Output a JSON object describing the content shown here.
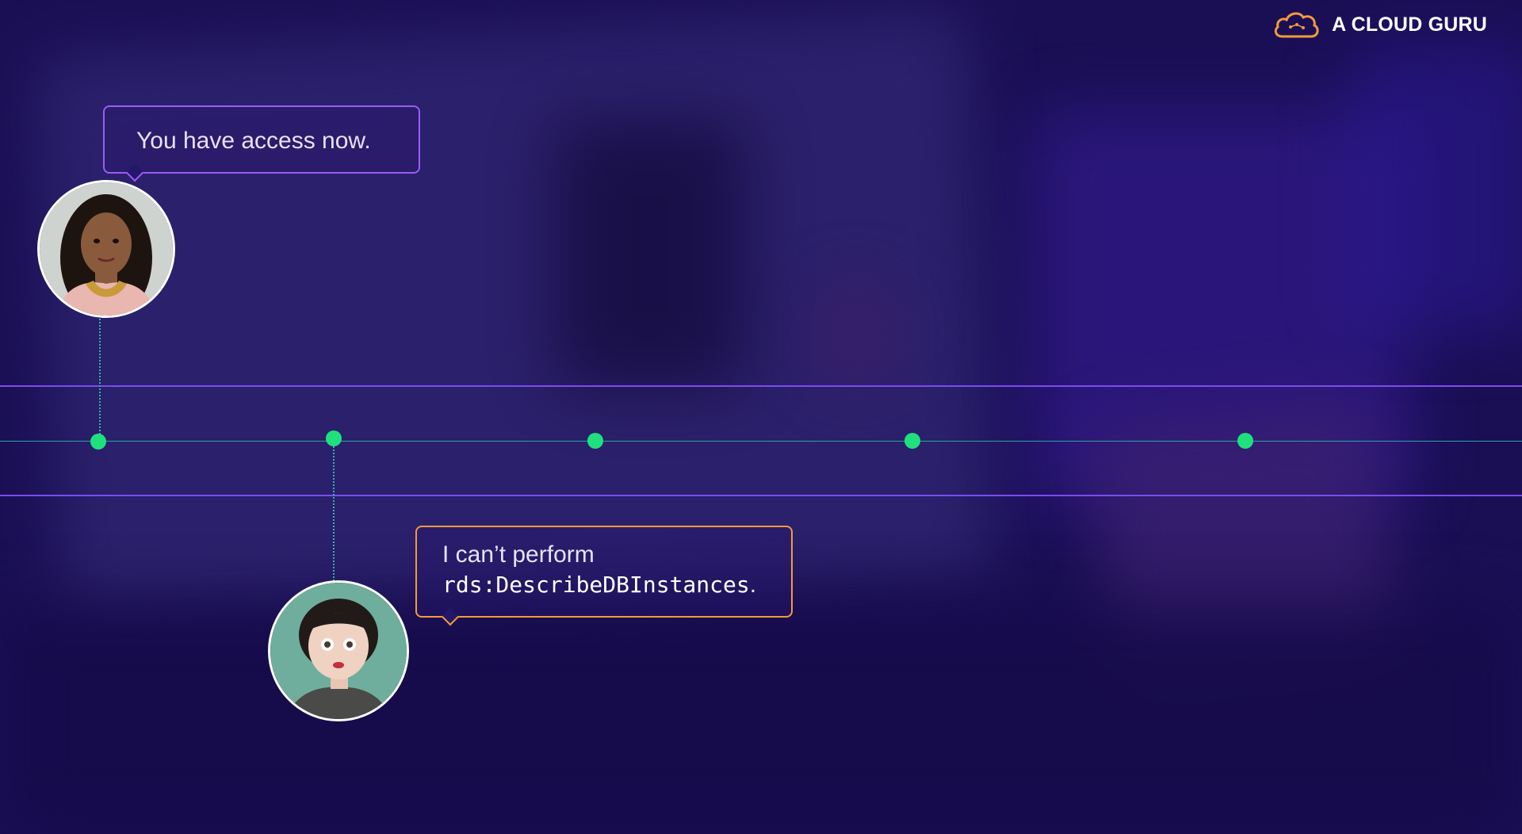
{
  "brand": {
    "logo_text": "A CLOUD GURU",
    "icon": "cloud-icon",
    "accent": "#f39a3c"
  },
  "colors": {
    "background": "#1a0f55",
    "line_purple": "#7a4cf0",
    "line_teal": "#2aa59a",
    "dot_green": "#1fe07d",
    "bubble_purple": "#9a5cf5",
    "bubble_orange": "#f39a3c"
  },
  "timeline": {
    "points": 5
  },
  "messages": {
    "top": {
      "text": "You have access now.",
      "avatar": "woman-avatar-icon"
    },
    "bottom": {
      "line1": "I can’t perform",
      "code": "rds:DescribeDBInstances",
      "suffix": ".",
      "avatar": "woman-cartoon-avatar-icon"
    }
  }
}
